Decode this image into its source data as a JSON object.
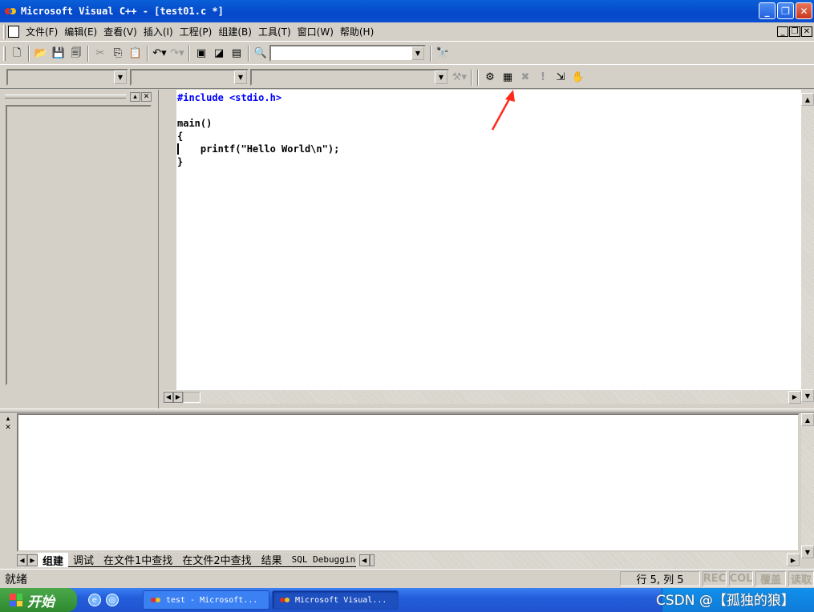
{
  "window": {
    "title": "Microsoft Visual C++ - [test01.c *]"
  },
  "menu": {
    "items": [
      "文件(F)",
      "编辑(E)",
      "查看(V)",
      "插入(I)",
      "工程(P)",
      "组建(B)",
      "工具(T)",
      "窗口(W)",
      "帮助(H)"
    ]
  },
  "toolbar": {
    "find_value": ""
  },
  "editor": {
    "lines": [
      "#include <stdio.h>",
      "",
      "main()",
      "{",
      "    printf(\"Hello World\\n\");",
      "}"
    ]
  },
  "output": {
    "tabs": [
      "组建",
      "调试",
      "在文件1中查找",
      "在文件2中查找",
      "结果",
      "SQL Debugging"
    ]
  },
  "status": {
    "text": "就绪",
    "position": "行 5, 列 5",
    "rec": "REC",
    "col": "COL",
    "ovr": "覆盖",
    "read": "读取"
  },
  "taskbar": {
    "start": "开始",
    "tasks": [
      "test - Microsoft...",
      "Microsoft Visual..."
    ]
  },
  "watermark": "CSDN @【孤独的狼】",
  "colors": {
    "keyword": "#0000ff",
    "arrow": "#ff2a1a",
    "titlebar": "#0548c9",
    "taskbar": "#245edb"
  }
}
